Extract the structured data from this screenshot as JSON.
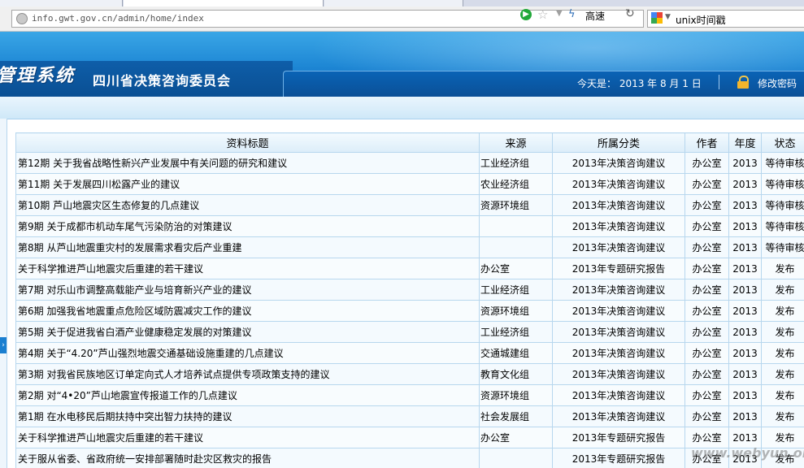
{
  "browser": {
    "url": "info.gwt.gov.cn/admin/home/index",
    "speed_label": "高速",
    "search_query": "unix时间戳"
  },
  "header": {
    "system_title": "管理系统",
    "org_name": "四川省决策咨询委员会",
    "date_text": "今天是： 2013 年 8 月 1 日",
    "change_password": "修改密码"
  },
  "table": {
    "columns": [
      "资料标题",
      "来源",
      "所属分类",
      "作者",
      "年度",
      "状态"
    ],
    "rows": [
      {
        "title": "第12期 关于我省战略性新兴产业发展中有关问题的研究和建议",
        "source": "工业经济组",
        "category": "2013年决策咨询建议",
        "author": "办公室",
        "year": "2013",
        "status": "等待审核"
      },
      {
        "title": "第11期 关于发展四川松露产业的建议",
        "source": "农业经济组",
        "category": "2013年决策咨询建议",
        "author": "办公室",
        "year": "2013",
        "status": "等待审核"
      },
      {
        "title": "第10期 芦山地震灾区生态修复的几点建议",
        "source": "资源环境组",
        "category": "2013年决策咨询建议",
        "author": "办公室",
        "year": "2013",
        "status": "等待审核"
      },
      {
        "title": "第9期 关于成都市机动车尾气污染防治的对策建议",
        "source": "",
        "category": "2013年决策咨询建议",
        "author": "办公室",
        "year": "2013",
        "status": "等待审核"
      },
      {
        "title": "第8期 从芦山地震重灾村的发展需求看灾后产业重建",
        "source": "",
        "category": "2013年决策咨询建议",
        "author": "办公室",
        "year": "2013",
        "status": "等待审核"
      },
      {
        "title": "关于科学推进芦山地震灾后重建的若干建议",
        "source": "办公室",
        "category": "2013年专题研究报告",
        "author": "办公室",
        "year": "2013",
        "status": "发布"
      },
      {
        "title": "第7期 对乐山市调整高载能产业与培育新兴产业的建议",
        "source": "工业经济组",
        "category": "2013年决策咨询建议",
        "author": "办公室",
        "year": "2013",
        "status": "发布"
      },
      {
        "title": "第6期 加强我省地震重点危险区域防震减灾工作的建议",
        "source": "资源环境组",
        "category": "2013年决策咨询建议",
        "author": "办公室",
        "year": "2013",
        "status": "发布"
      },
      {
        "title": "第5期 关于促进我省白酒产业健康稳定发展的对策建议",
        "source": "工业经济组",
        "category": "2013年决策咨询建议",
        "author": "办公室",
        "year": "2013",
        "status": "发布"
      },
      {
        "title": "第4期 关于“4.20”芦山强烈地震交通基础设施重建的几点建议",
        "source": "交通城建组",
        "category": "2013年决策咨询建议",
        "author": "办公室",
        "year": "2013",
        "status": "发布"
      },
      {
        "title": "第3期 对我省民族地区订单定向式人才培养试点提供专项政策支持的建议",
        "source": "教育文化组",
        "category": "2013年决策咨询建议",
        "author": "办公室",
        "year": "2013",
        "status": "发布"
      },
      {
        "title": "第2期 对“4•20”芦山地震宣传报道工作的几点建议",
        "source": "资源环境组",
        "category": "2013年决策咨询建议",
        "author": "办公室",
        "year": "2013",
        "status": "发布"
      },
      {
        "title": "第1期 在水电移民后期扶持中突出智力扶持的建议",
        "source": "社会发展组",
        "category": "2013年决策咨询建议",
        "author": "办公室",
        "year": "2013",
        "status": "发布"
      },
      {
        "title": "关于科学推进芦山地震灾后重建的若干建议",
        "source": "办公室",
        "category": "2013年专题研究报告",
        "author": "办公室",
        "year": "2013",
        "status": "发布"
      },
      {
        "title": "关于服从省委、省政府统一安排部署随时赴灾区救灾的报告",
        "source": "",
        "category": "2013年专题研究报告",
        "author": "办公室",
        "year": "2013",
        "status": "发布"
      }
    ]
  },
  "watermark": "www.webyun.org",
  "colors": {
    "header_blue": "#1d86d4",
    "table_border": "#b7d7ee",
    "go_green": "#22a83a"
  }
}
